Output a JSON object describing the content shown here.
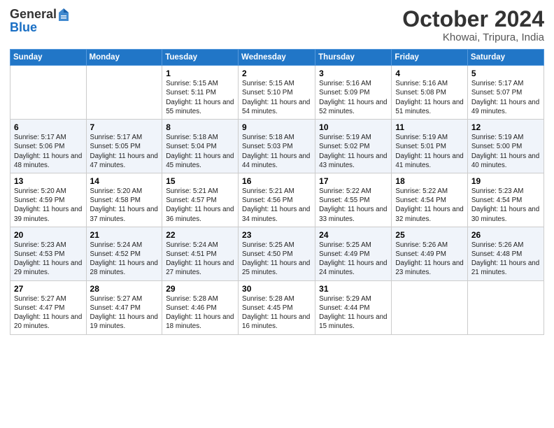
{
  "header": {
    "logo_general": "General",
    "logo_blue": "Blue",
    "month": "October 2024",
    "location": "Khowai, Tripura, India"
  },
  "days_of_week": [
    "Sunday",
    "Monday",
    "Tuesday",
    "Wednesday",
    "Thursday",
    "Friday",
    "Saturday"
  ],
  "weeks": [
    [
      {
        "day": "",
        "info": ""
      },
      {
        "day": "",
        "info": ""
      },
      {
        "day": "1",
        "info": "Sunrise: 5:15 AM\nSunset: 5:11 PM\nDaylight: 11 hours and 55 minutes."
      },
      {
        "day": "2",
        "info": "Sunrise: 5:15 AM\nSunset: 5:10 PM\nDaylight: 11 hours and 54 minutes."
      },
      {
        "day": "3",
        "info": "Sunrise: 5:16 AM\nSunset: 5:09 PM\nDaylight: 11 hours and 52 minutes."
      },
      {
        "day": "4",
        "info": "Sunrise: 5:16 AM\nSunset: 5:08 PM\nDaylight: 11 hours and 51 minutes."
      },
      {
        "day": "5",
        "info": "Sunrise: 5:17 AM\nSunset: 5:07 PM\nDaylight: 11 hours and 49 minutes."
      }
    ],
    [
      {
        "day": "6",
        "info": "Sunrise: 5:17 AM\nSunset: 5:06 PM\nDaylight: 11 hours and 48 minutes."
      },
      {
        "day": "7",
        "info": "Sunrise: 5:17 AM\nSunset: 5:05 PM\nDaylight: 11 hours and 47 minutes."
      },
      {
        "day": "8",
        "info": "Sunrise: 5:18 AM\nSunset: 5:04 PM\nDaylight: 11 hours and 45 minutes."
      },
      {
        "day": "9",
        "info": "Sunrise: 5:18 AM\nSunset: 5:03 PM\nDaylight: 11 hours and 44 minutes."
      },
      {
        "day": "10",
        "info": "Sunrise: 5:19 AM\nSunset: 5:02 PM\nDaylight: 11 hours and 43 minutes."
      },
      {
        "day": "11",
        "info": "Sunrise: 5:19 AM\nSunset: 5:01 PM\nDaylight: 11 hours and 41 minutes."
      },
      {
        "day": "12",
        "info": "Sunrise: 5:19 AM\nSunset: 5:00 PM\nDaylight: 11 hours and 40 minutes."
      }
    ],
    [
      {
        "day": "13",
        "info": "Sunrise: 5:20 AM\nSunset: 4:59 PM\nDaylight: 11 hours and 39 minutes."
      },
      {
        "day": "14",
        "info": "Sunrise: 5:20 AM\nSunset: 4:58 PM\nDaylight: 11 hours and 37 minutes."
      },
      {
        "day": "15",
        "info": "Sunrise: 5:21 AM\nSunset: 4:57 PM\nDaylight: 11 hours and 36 minutes."
      },
      {
        "day": "16",
        "info": "Sunrise: 5:21 AM\nSunset: 4:56 PM\nDaylight: 11 hours and 34 minutes."
      },
      {
        "day": "17",
        "info": "Sunrise: 5:22 AM\nSunset: 4:55 PM\nDaylight: 11 hours and 33 minutes."
      },
      {
        "day": "18",
        "info": "Sunrise: 5:22 AM\nSunset: 4:54 PM\nDaylight: 11 hours and 32 minutes."
      },
      {
        "day": "19",
        "info": "Sunrise: 5:23 AM\nSunset: 4:54 PM\nDaylight: 11 hours and 30 minutes."
      }
    ],
    [
      {
        "day": "20",
        "info": "Sunrise: 5:23 AM\nSunset: 4:53 PM\nDaylight: 11 hours and 29 minutes."
      },
      {
        "day": "21",
        "info": "Sunrise: 5:24 AM\nSunset: 4:52 PM\nDaylight: 11 hours and 28 minutes."
      },
      {
        "day": "22",
        "info": "Sunrise: 5:24 AM\nSunset: 4:51 PM\nDaylight: 11 hours and 27 minutes."
      },
      {
        "day": "23",
        "info": "Sunrise: 5:25 AM\nSunset: 4:50 PM\nDaylight: 11 hours and 25 minutes."
      },
      {
        "day": "24",
        "info": "Sunrise: 5:25 AM\nSunset: 4:49 PM\nDaylight: 11 hours and 24 minutes."
      },
      {
        "day": "25",
        "info": "Sunrise: 5:26 AM\nSunset: 4:49 PM\nDaylight: 11 hours and 23 minutes."
      },
      {
        "day": "26",
        "info": "Sunrise: 5:26 AM\nSunset: 4:48 PM\nDaylight: 11 hours and 21 minutes."
      }
    ],
    [
      {
        "day": "27",
        "info": "Sunrise: 5:27 AM\nSunset: 4:47 PM\nDaylight: 11 hours and 20 minutes."
      },
      {
        "day": "28",
        "info": "Sunrise: 5:27 AM\nSunset: 4:47 PM\nDaylight: 11 hours and 19 minutes."
      },
      {
        "day": "29",
        "info": "Sunrise: 5:28 AM\nSunset: 4:46 PM\nDaylight: 11 hours and 18 minutes."
      },
      {
        "day": "30",
        "info": "Sunrise: 5:28 AM\nSunset: 4:45 PM\nDaylight: 11 hours and 16 minutes."
      },
      {
        "day": "31",
        "info": "Sunrise: 5:29 AM\nSunset: 4:44 PM\nDaylight: 11 hours and 15 minutes."
      },
      {
        "day": "",
        "info": ""
      },
      {
        "day": "",
        "info": ""
      }
    ]
  ]
}
